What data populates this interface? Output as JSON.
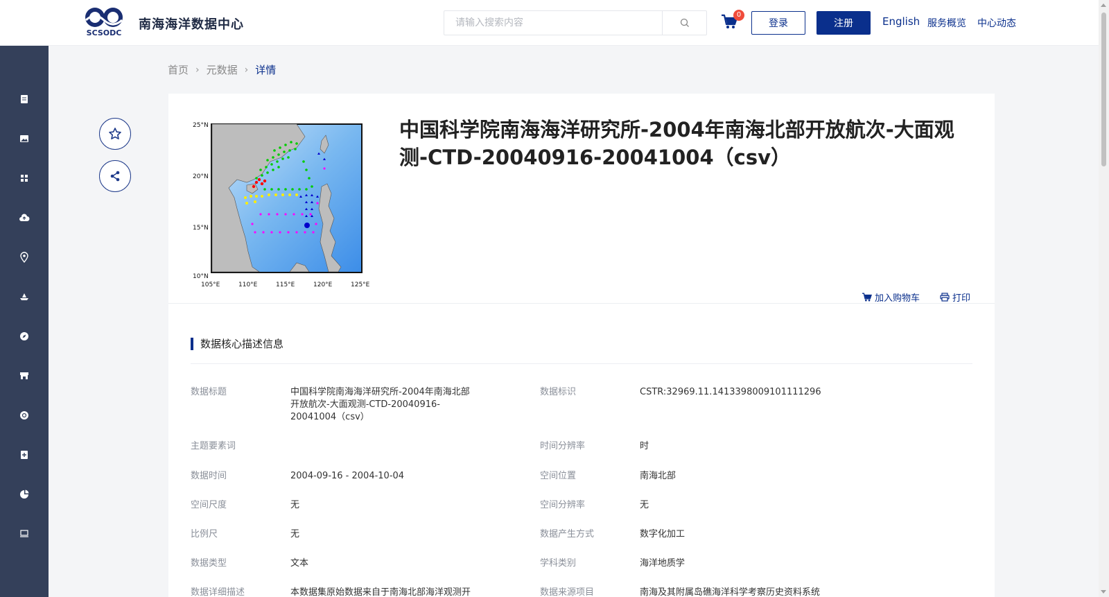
{
  "header": {
    "site_title": "南海海洋数据中心",
    "logo_text": "SCSODC",
    "search_placeholder": "请输入搜索内容",
    "cart_count": "0",
    "login": "登录",
    "register": "注册",
    "nav": [
      "English",
      "服务概览",
      "中心动态"
    ]
  },
  "sidebar": {
    "items": [
      "document-icon",
      "image-icon",
      "grid-icon",
      "cloud-upload-icon",
      "location-pin-icon",
      "ship-icon",
      "compass-icon",
      "store-icon",
      "globe-icon",
      "plus-doc-icon",
      "pie-chart-icon",
      "monitor-icon"
    ]
  },
  "breadcrumb": [
    "首页",
    "元数据",
    "详情"
  ],
  "detail": {
    "title": "中国科学院南海海洋研究所-2004年南海北部开放航次-大面观测-CTD-20040916-20041004（csv）",
    "add_to_cart": "加入购物车",
    "print": "打印",
    "section_title": "数据核心描述信息",
    "map_axis": {
      "lat": [
        "25°N",
        "20°N",
        "15°N",
        "10°N"
      ],
      "lon": [
        "105°E",
        "110°E",
        "115°E",
        "120°E",
        "125°E"
      ]
    },
    "fields_left": [
      {
        "label": "数据标题",
        "value": "中国科学院南海海洋研究所-2004年南海北部开放航次-大面观测-CTD-20040916-20041004（csv）"
      },
      {
        "label": "主题要素词",
        "value": ""
      },
      {
        "label": "数据时间",
        "value": "2004-09-16 - 2004-10-04"
      },
      {
        "label": "空间尺度",
        "value": "无"
      },
      {
        "label": "比例尺",
        "value": "无"
      },
      {
        "label": "数据类型",
        "value": "文本"
      },
      {
        "label": "数据详细描述",
        "value": "本数据集原始数据来自于南海北部海洋观测开"
      }
    ],
    "fields_right": [
      {
        "label": "数据标识",
        "value": "CSTR:32969.11.1413398009101111296"
      },
      {
        "label": "时间分辨率",
        "value": "时"
      },
      {
        "label": "空间位置",
        "value": "南海北部"
      },
      {
        "label": "空间分辨率",
        "value": "无"
      },
      {
        "label": "数据产生方式",
        "value": "数字化加工"
      },
      {
        "label": "学科类别",
        "value": "海洋地质学"
      },
      {
        "label": "数据来源项目",
        "value": "南海及其附属岛礁海洋科学考察历史资料系统"
      }
    ]
  }
}
